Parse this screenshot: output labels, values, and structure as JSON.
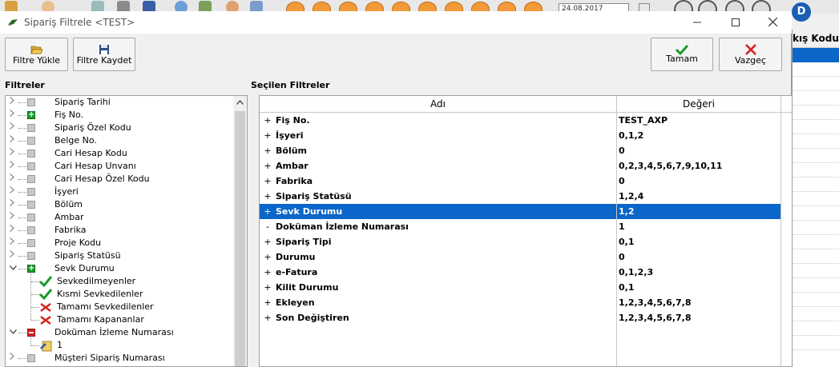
{
  "colors": {
    "selection": "#0a66c8",
    "check_green": "#1a9a2a",
    "cross_red": "#d52020",
    "accent_orange": "#f29a3a"
  },
  "background": {
    "date_value": "24.08.2017",
    "avatar_letter": "D",
    "right_column_header": "kış Kodu"
  },
  "window": {
    "title": "Sipariş Filtrele <TEST>",
    "minimize_icon": "minimize-icon",
    "maximize_icon": "maximize-icon",
    "close_icon": "close-icon"
  },
  "toolbar": {
    "load_filter": {
      "label": "Filtre Yükle",
      "icon": "folder-open-icon"
    },
    "save_filter": {
      "label": "Filtre Kaydet",
      "icon": "floppy-disk-icon"
    },
    "ok": {
      "label": "Tamam",
      "icon": "checkmark-icon"
    },
    "cancel": {
      "label": "Vazgeç",
      "icon": "cross-icon"
    }
  },
  "sections": {
    "filters": "Filtreler",
    "selected_filters": "Seçilen Filtreler"
  },
  "tree": {
    "items": [
      {
        "label": "Sipariş Tarihi",
        "state": "gray",
        "expanded": false
      },
      {
        "label": "Fiş No.",
        "state": "green",
        "expanded": false
      },
      {
        "label": "Sipariş Özel Kodu",
        "state": "gray",
        "expanded": false
      },
      {
        "label": "Belge No.",
        "state": "gray",
        "expanded": false
      },
      {
        "label": "Cari Hesap Kodu",
        "state": "gray",
        "expanded": false
      },
      {
        "label": "Cari Hesap Unvanı",
        "state": "gray",
        "expanded": false
      },
      {
        "label": "Cari Hesap Özel Kodu",
        "state": "gray",
        "expanded": false
      },
      {
        "label": "İşyeri",
        "state": "gray",
        "expanded": false
      },
      {
        "label": "Bölüm",
        "state": "gray",
        "expanded": false
      },
      {
        "label": "Ambar",
        "state": "gray",
        "expanded": false
      },
      {
        "label": "Fabrika",
        "state": "gray",
        "expanded": false
      },
      {
        "label": "Proje Kodu",
        "state": "gray",
        "expanded": false
      },
      {
        "label": "Sipariş Statüsü",
        "state": "gray",
        "expanded": false
      },
      {
        "label": "Sevk Durumu",
        "state": "green",
        "expanded": true,
        "children": [
          {
            "label": "Sevkedilmeyenler",
            "icon": "check"
          },
          {
            "label": "Kısmi Sevkedilenler",
            "icon": "check"
          },
          {
            "label": "Tamamı Sevkedilenler",
            "icon": "cross"
          },
          {
            "label": "Tamamı Kapananlar",
            "icon": "cross"
          }
        ]
      },
      {
        "label": "Doküman İzleme Numarası",
        "state": "red",
        "expanded": true,
        "children": [
          {
            "label": "1",
            "icon": "edit"
          }
        ]
      },
      {
        "label": "Müşteri Sipariş Numarası",
        "state": "gray",
        "expanded": false
      }
    ]
  },
  "grid": {
    "columns": [
      "Adı",
      "Değeri"
    ],
    "rows": [
      {
        "expander": "+",
        "name": "Fiş No.",
        "value": "TEST_AXP",
        "selected": false
      },
      {
        "expander": "+",
        "name": "İşyeri",
        "value": "0,1,2",
        "selected": false
      },
      {
        "expander": "+",
        "name": "Bölüm",
        "value": "0",
        "selected": false
      },
      {
        "expander": "+",
        "name": "Ambar",
        "value": "0,2,3,4,5,6,7,9,10,11",
        "selected": false
      },
      {
        "expander": "+",
        "name": "Fabrika",
        "value": "0",
        "selected": false
      },
      {
        "expander": "+",
        "name": "Sipariş Statüsü",
        "value": "1,2,4",
        "selected": false
      },
      {
        "expander": "+",
        "name": "Sevk Durumu",
        "value": "1,2",
        "selected": true
      },
      {
        "expander": "-",
        "name": "Doküman İzleme Numarası",
        "value": "1",
        "selected": false
      },
      {
        "expander": "+",
        "name": "Sipariş Tipi",
        "value": "0,1",
        "selected": false
      },
      {
        "expander": "+",
        "name": "Durumu",
        "value": "0",
        "selected": false
      },
      {
        "expander": "+",
        "name": "e-Fatura",
        "value": "0,1,2,3",
        "selected": false
      },
      {
        "expander": "+",
        "name": "Kilit Durumu",
        "value": "0,1",
        "selected": false
      },
      {
        "expander": "+",
        "name": "Ekleyen",
        "value": "1,2,3,4,5,6,7,8",
        "selected": false
      },
      {
        "expander": "+",
        "name": "Son Değiştiren",
        "value": "1,2,3,4,5,6,7,8",
        "selected": false
      }
    ]
  }
}
